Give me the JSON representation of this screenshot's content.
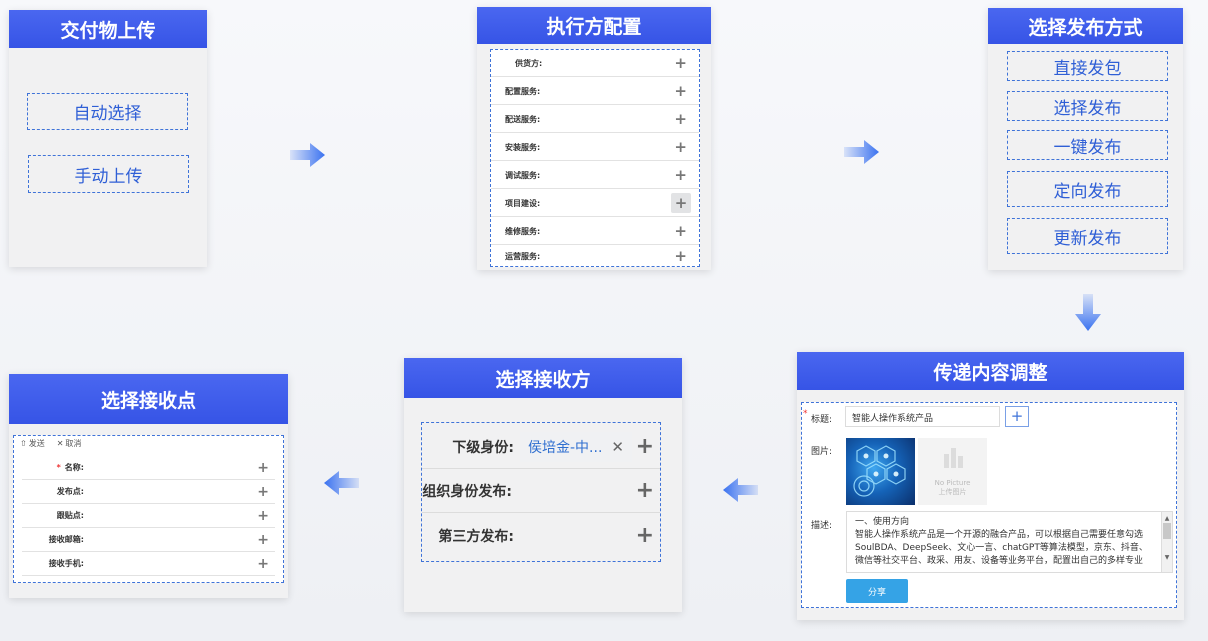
{
  "deliverable_upload": {
    "title": "交付物上传",
    "options": [
      "自动选择",
      "手动上传"
    ]
  },
  "executor_config": {
    "title": "执行方配置",
    "rows": [
      {
        "label": "供货方:"
      },
      {
        "label": "配置服务:"
      },
      {
        "label": "配送服务:"
      },
      {
        "label": "安装服务:"
      },
      {
        "label": "调试服务:"
      },
      {
        "label": "项目建设:"
      },
      {
        "label": "维修服务:"
      },
      {
        "label": "运营服务:"
      }
    ]
  },
  "publish_method": {
    "title": "选择发布方式",
    "options": [
      "直接发包",
      "选择发布",
      "一键发布",
      "定向发布",
      "更新发布"
    ]
  },
  "content_adjust": {
    "title": "传递内容调整",
    "required_mark": "*",
    "title_label": "标题:",
    "title_value": "智能人操作系统产品",
    "image_label": "图片:",
    "placeholder_line1": "No Picture",
    "placeholder_line2": "上传图片",
    "desc_label": "描述:",
    "desc_heading": "一、使用方向",
    "desc_line1": "智能人操作系统产品是一个开源的融合产品，可以根据自己需要任意勾选",
    "desc_line2": "SoulBDA、DeepSeek、文心一言、chatGPT等算法模型，京东、抖音、",
    "desc_line3": "微信等社交平台、政采、用友、设备等业务平台，配置出自己的多样专业",
    "share_button": "分享"
  },
  "select_recipient": {
    "title": "选择接收方",
    "rows": [
      {
        "label": "下级身份:",
        "chip": "侯培金-中..."
      },
      {
        "label": "组织身份发布:"
      },
      {
        "label": "第三方发布:"
      }
    ]
  },
  "select_receiving_point": {
    "title": "选择接收点",
    "send_label": "发送",
    "cancel_label": "取消",
    "required_mark": "*",
    "rows": [
      {
        "label": "名称:"
      },
      {
        "label": "发布点:"
      },
      {
        "label": "跟贴点:"
      },
      {
        "label": "接收邮箱:"
      },
      {
        "label": "接收手机:"
      }
    ]
  },
  "colors": {
    "header": "#3654e6",
    "accent": "#2f5fd6",
    "dashed_border": "#3f73d8",
    "share_button": "#35a3e6",
    "arrow": "#3a72f0"
  },
  "icons": {
    "plus": "plus-icon",
    "close": "close-icon",
    "send": "send-icon",
    "arrow_right": "arrow-right-icon",
    "arrow_left": "arrow-left-icon",
    "arrow_down": "arrow-down-icon"
  }
}
